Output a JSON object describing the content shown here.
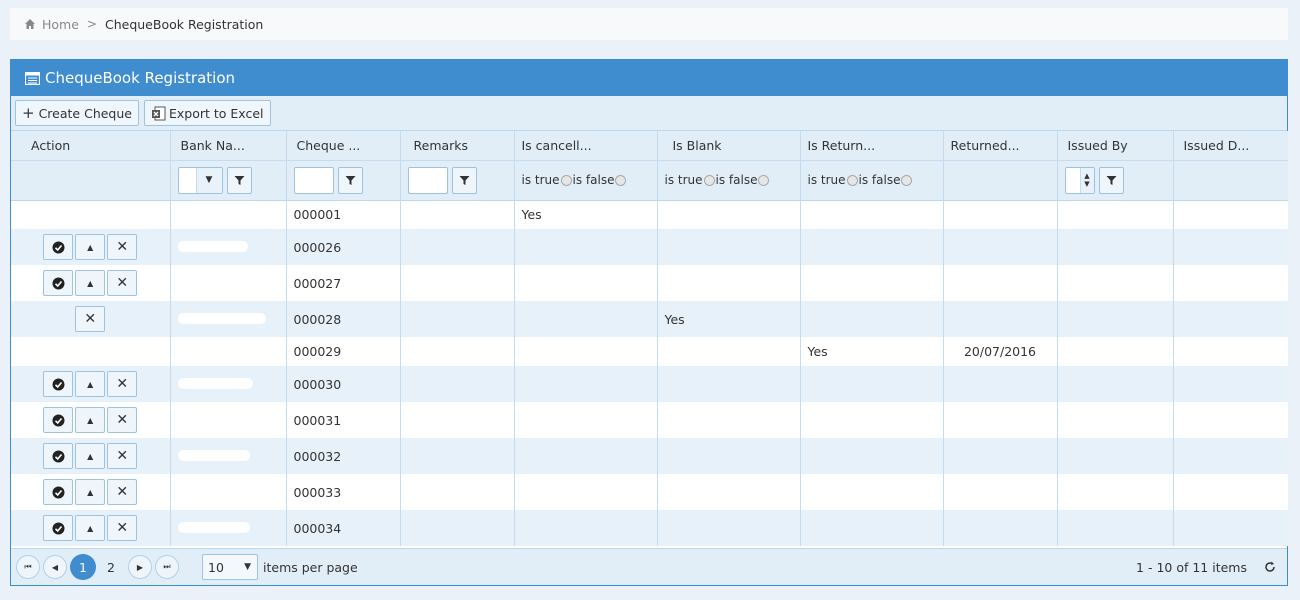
{
  "breadcrumb": {
    "home": "Home",
    "separator": ">",
    "current": "ChequeBook Registration",
    "home_icon": "home-icon"
  },
  "panel": {
    "title": "ChequeBook Registration",
    "icon": "list-icon"
  },
  "toolbar": {
    "create_label": "Create Cheque",
    "export_label": "Export to Excel"
  },
  "columns": [
    "Action",
    "Bank Na...",
    "Cheque ...",
    "Remarks",
    "Is cancell...",
    "Is Blank",
    "Is Return...",
    "Returned...",
    "Issued By",
    "Issued D..."
  ],
  "filters": {
    "is_true": "is true",
    "is_false": "is false"
  },
  "rows": [
    {
      "cheque": "000001",
      "cancelled": "Yes",
      "blank": "",
      "returned": "",
      "returned_date": ""
    },
    {
      "cheque": "000026",
      "cancelled": "",
      "blank": "",
      "returned": "",
      "returned_date": ""
    },
    {
      "cheque": "000027",
      "cancelled": "",
      "blank": "",
      "returned": "",
      "returned_date": ""
    },
    {
      "cheque": "000028",
      "cancelled": "",
      "blank": "Yes",
      "returned": "",
      "returned_date": ""
    },
    {
      "cheque": "000029",
      "cancelled": "",
      "blank": "",
      "returned": "Yes",
      "returned_date": "20/07/2016"
    },
    {
      "cheque": "000030",
      "cancelled": "",
      "blank": "",
      "returned": "",
      "returned_date": ""
    },
    {
      "cheque": "000031",
      "cancelled": "",
      "blank": "",
      "returned": "",
      "returned_date": ""
    },
    {
      "cheque": "000032",
      "cancelled": "",
      "blank": "",
      "returned": "",
      "returned_date": ""
    },
    {
      "cheque": "000033",
      "cancelled": "",
      "blank": "",
      "returned": "",
      "returned_date": ""
    },
    {
      "cheque": "000034",
      "cancelled": "",
      "blank": "",
      "returned": "",
      "returned_date": ""
    }
  ],
  "pager": {
    "pages": [
      "1",
      "2"
    ],
    "current_page": "1",
    "page_size": "10",
    "items_per_page_label": "items per page",
    "info": "1 - 10 of 11 items"
  },
  "colors": {
    "header_blue": "#3f8ccf",
    "toolbar_bg": "#e1eef8",
    "alt_row": "#e7f1f9"
  }
}
